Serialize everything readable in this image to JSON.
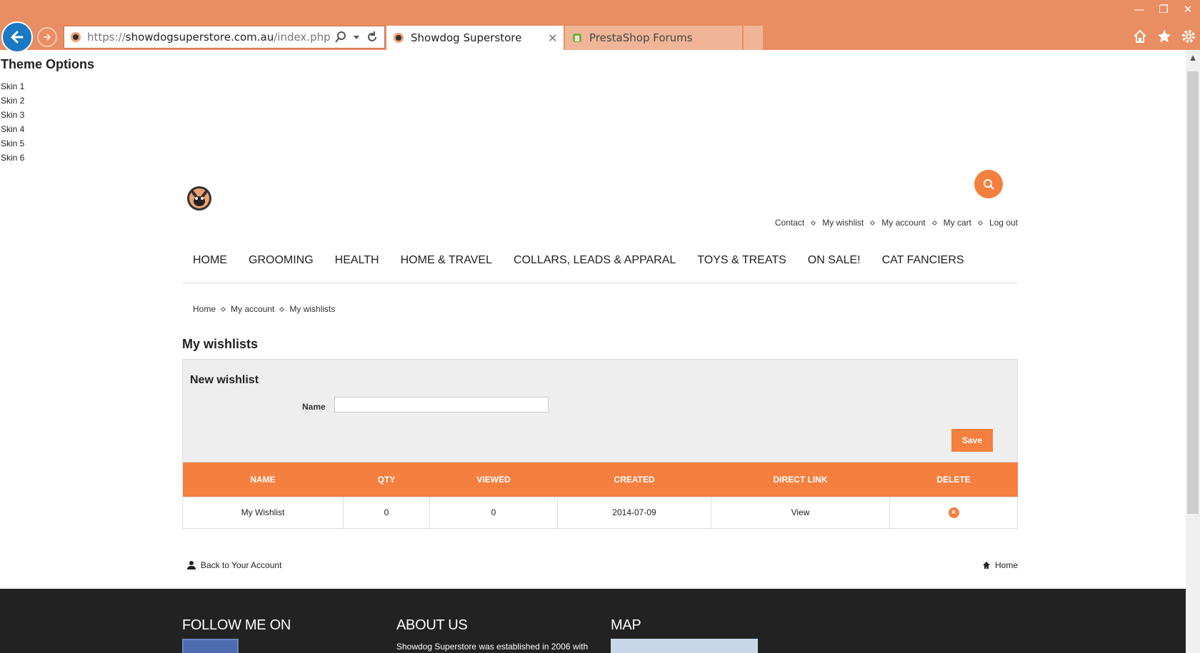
{
  "browser": {
    "url_prefix": "https://",
    "url_domain": "showdogsuperstore.com.au",
    "url_path": "/index.php?fc=n",
    "tabs": [
      {
        "title": "Showdog Superstore",
        "active": true
      },
      {
        "title": "PrestaShop Forums",
        "active": false
      }
    ],
    "close_glyph": "✕",
    "window_controls": {
      "minimize": "—",
      "restore": "❐",
      "close": "✕"
    }
  },
  "theme_options": {
    "title": "Theme Options",
    "skins": [
      "Skin 1",
      "Skin 2",
      "Skin 3",
      "Skin 4",
      "Skin 5",
      "Skin 6"
    ]
  },
  "header": {
    "top_links": [
      "Contact",
      "My wishlist",
      "My account",
      "My cart",
      "Log out"
    ]
  },
  "main_nav": [
    "HOME",
    "GROOMING",
    "HEALTH",
    "HOME & TRAVEL",
    "COLLARS, LEADS & APPARAL",
    "TOYS & TREATS",
    "ON SALE!",
    "CAT FANCIERS"
  ],
  "breadcrumb": [
    "Home",
    "My account",
    "My wishlists"
  ],
  "page_title": "My wishlists",
  "new_wishlist": {
    "heading": "New wishlist",
    "name_label": "Name",
    "name_value": "",
    "save_label": "Save"
  },
  "wishlist_table": {
    "headers": [
      "NAME",
      "QTY",
      "VIEWED",
      "CREATED",
      "DIRECT LINK",
      "DELETE"
    ],
    "rows": [
      {
        "name": "My Wishlist",
        "qty": "0",
        "viewed": "0",
        "created": "2014-07-09",
        "link": "View",
        "delete_glyph": "×"
      }
    ]
  },
  "footer_links": {
    "back": "Back to Your Account",
    "home": "Home"
  },
  "footer": {
    "follow_title": "FOLLOW ME ON",
    "about_title": "ABOUT US",
    "about_text": "Showdog Superstore was established in 2006 with",
    "map_title": "MAP"
  },
  "colors": {
    "accent": "#f47f3f",
    "chrome": "#e98d62",
    "footer_bg": "#222222"
  }
}
